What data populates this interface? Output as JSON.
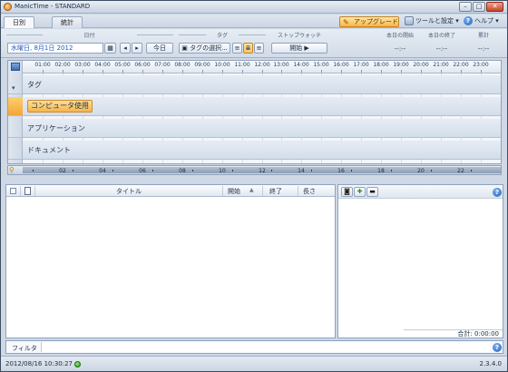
{
  "window": {
    "title": "ManicTime - STANDARD",
    "minimize": "–",
    "maximize": "□",
    "close": "✕"
  },
  "tabs": [
    {
      "label": "日別",
      "active": true
    },
    {
      "label": "統計",
      "active": false
    }
  ],
  "header": {
    "upgrade": "アップグレード",
    "tools_settings": "ツールと設定 ▾",
    "help": "ヘルプ ▾"
  },
  "toolbar": {
    "date_group": "日付",
    "date_value": "水曜日, 8月1日 2012",
    "today": "今日",
    "tags_group": "タグ",
    "tag_select": "タグの選択...",
    "stopwatch_group": "ストップウォッチ",
    "start": "開始",
    "today_start_label": "本日の開始",
    "today_end_label": "本日の終了",
    "total_label": "累計",
    "today_start_value": "--:--",
    "today_end_value": "--:--",
    "total_value": "--:--"
  },
  "timeline": {
    "hours": [
      "01:00",
      "02:00",
      "03:00",
      "04:00",
      "05:00",
      "06:00",
      "07:00",
      "08:00",
      "09:00",
      "10:00",
      "11:00",
      "12:00",
      "13:00",
      "14:00",
      "15:00",
      "16:00",
      "17:00",
      "18:00",
      "19:00",
      "20:00",
      "21:00",
      "22:00",
      "23:00"
    ],
    "lanes": [
      {
        "label": "タグ",
        "highlight": false
      },
      {
        "label": "コンピュータ使用",
        "highlight": true
      },
      {
        "label": "アプリケーション",
        "highlight": false
      },
      {
        "label": "ドキュメント",
        "highlight": false
      }
    ]
  },
  "zoom": {
    "labels": [
      "02",
      "04",
      "06",
      "08",
      "10",
      "12",
      "14",
      "16",
      "18",
      "20",
      "22"
    ]
  },
  "table": {
    "columns": [
      "タイトル",
      "開始",
      "終了",
      "長さ"
    ],
    "sort_indicator": "▲"
  },
  "side_panel": {
    "total": "合計: 0:00:00",
    "help": "?"
  },
  "filter": {
    "label": "フィルタ",
    "value": "",
    "help": "?"
  },
  "status": {
    "datetime": "2012/08/16 10:30:27",
    "version": "2.3.4.0"
  }
}
